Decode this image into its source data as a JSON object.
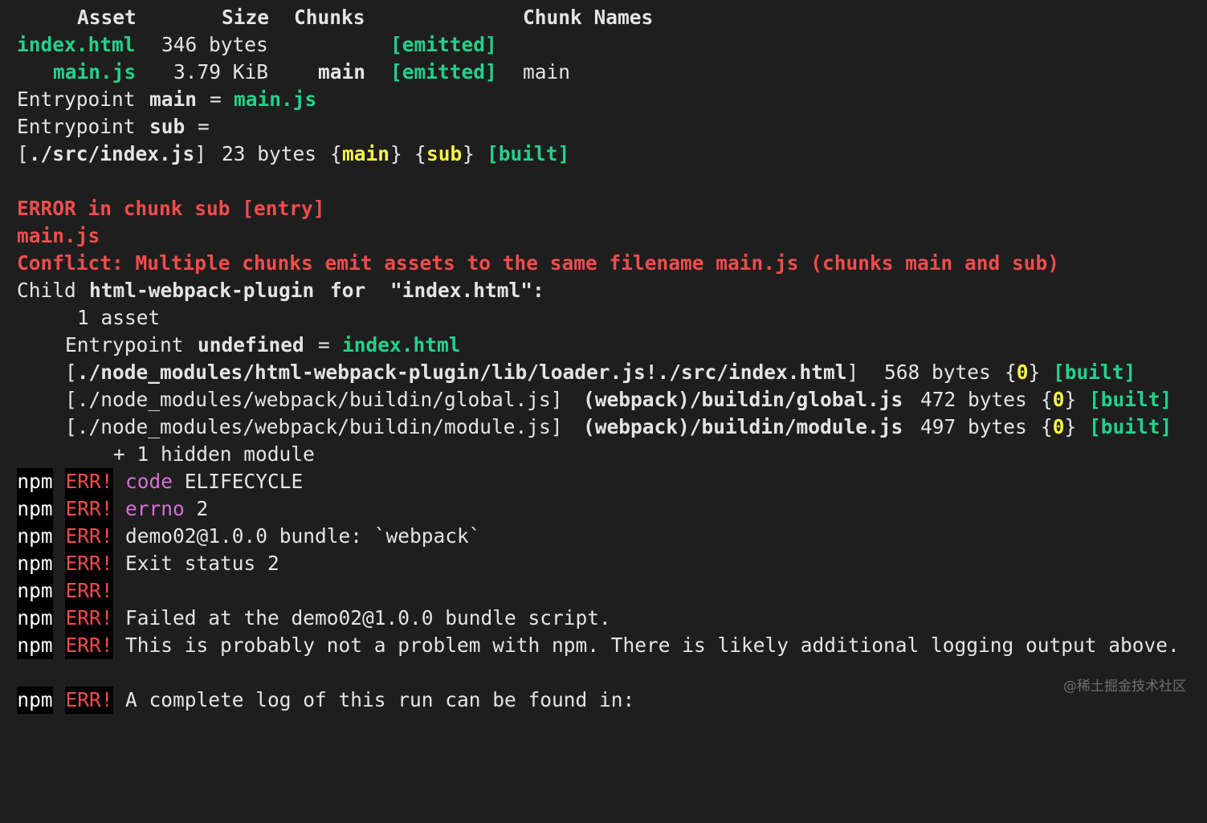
{
  "asset_table": {
    "headers": {
      "asset": "Asset",
      "size": "Size",
      "chunks": "Chunks",
      "chunk_names": "Chunk Names"
    },
    "rows": [
      {
        "asset": "index.html",
        "size": "346 bytes",
        "chunks": "",
        "emitted": "[emitted]",
        "chunk_name": ""
      },
      {
        "asset": "main.js",
        "size": "3.79 KiB",
        "chunks": "main",
        "emitted": "[emitted]",
        "chunk_name": "main"
      }
    ]
  },
  "entrypoints": {
    "word": "Entrypoint",
    "main_name": "main",
    "eq": "=",
    "main_file": "main.js",
    "sub_name": "sub",
    "module_path": "[./src/index.js]",
    "module_size": "23 bytes",
    "open_brace": "{",
    "close_brace": "}",
    "chunk_main": "main",
    "chunk_sub": "sub",
    "built": "[built]"
  },
  "error_block": {
    "line1": "ERROR in chunk sub [entry]",
    "line2": "main.js",
    "line3": "Conflict: Multiple chunks emit assets to the same filename main.js (chunks main and sub)"
  },
  "child": {
    "prefix": "Child",
    "plugin": "html-webpack-plugin",
    "for": "for",
    "target": "\"index.html\":",
    "asset_count": "1 asset",
    "entry_word": "Entrypoint",
    "entry_name": "undefined",
    "eq": "=",
    "entry_file": "index.html",
    "modules": [
      {
        "path": "[./node_modules/html-webpack-plugin/lib/loader.js!./src/index.html]",
        "alias": "",
        "size": "568 bytes",
        "chunk": "0",
        "built": "[built]"
      },
      {
        "path": "[./node_modules/webpack/buildin/global.js]",
        "alias": "(webpack)/buildin/global.js",
        "size": "472 bytes",
        "chunk": "0",
        "built": "[built]"
      },
      {
        "path": "[./node_modules/webpack/buildin/module.js]",
        "alias": "(webpack)/buildin/module.js",
        "size": "497 bytes",
        "chunk": "0",
        "built": "[built]"
      }
    ],
    "hidden": "+ 1 hidden module"
  },
  "npm_errors": {
    "npm_label": "npm",
    "err_label": "ERR!",
    "code_key": "code",
    "code_value": "ELIFECYCLE",
    "errno_key": "errno",
    "errno_value": "2",
    "lines": [
      "demo02@1.0.0 bundle: `webpack`",
      "Exit status 2",
      "",
      "Failed at the demo02@1.0.0 bundle script.",
      "This is probably not a problem with npm. There is likely additional logging output above.",
      "A complete log of this run can be found in:"
    ]
  },
  "watermark": "@稀土掘金技术社区",
  "colors": {
    "background": "#1e1e1e",
    "text": "#e4e4e4",
    "green": "#23d18b",
    "yellow": "#f5f543",
    "red": "#f14c4c",
    "magenta": "#d670d6",
    "badge_bg": "#000000"
  }
}
